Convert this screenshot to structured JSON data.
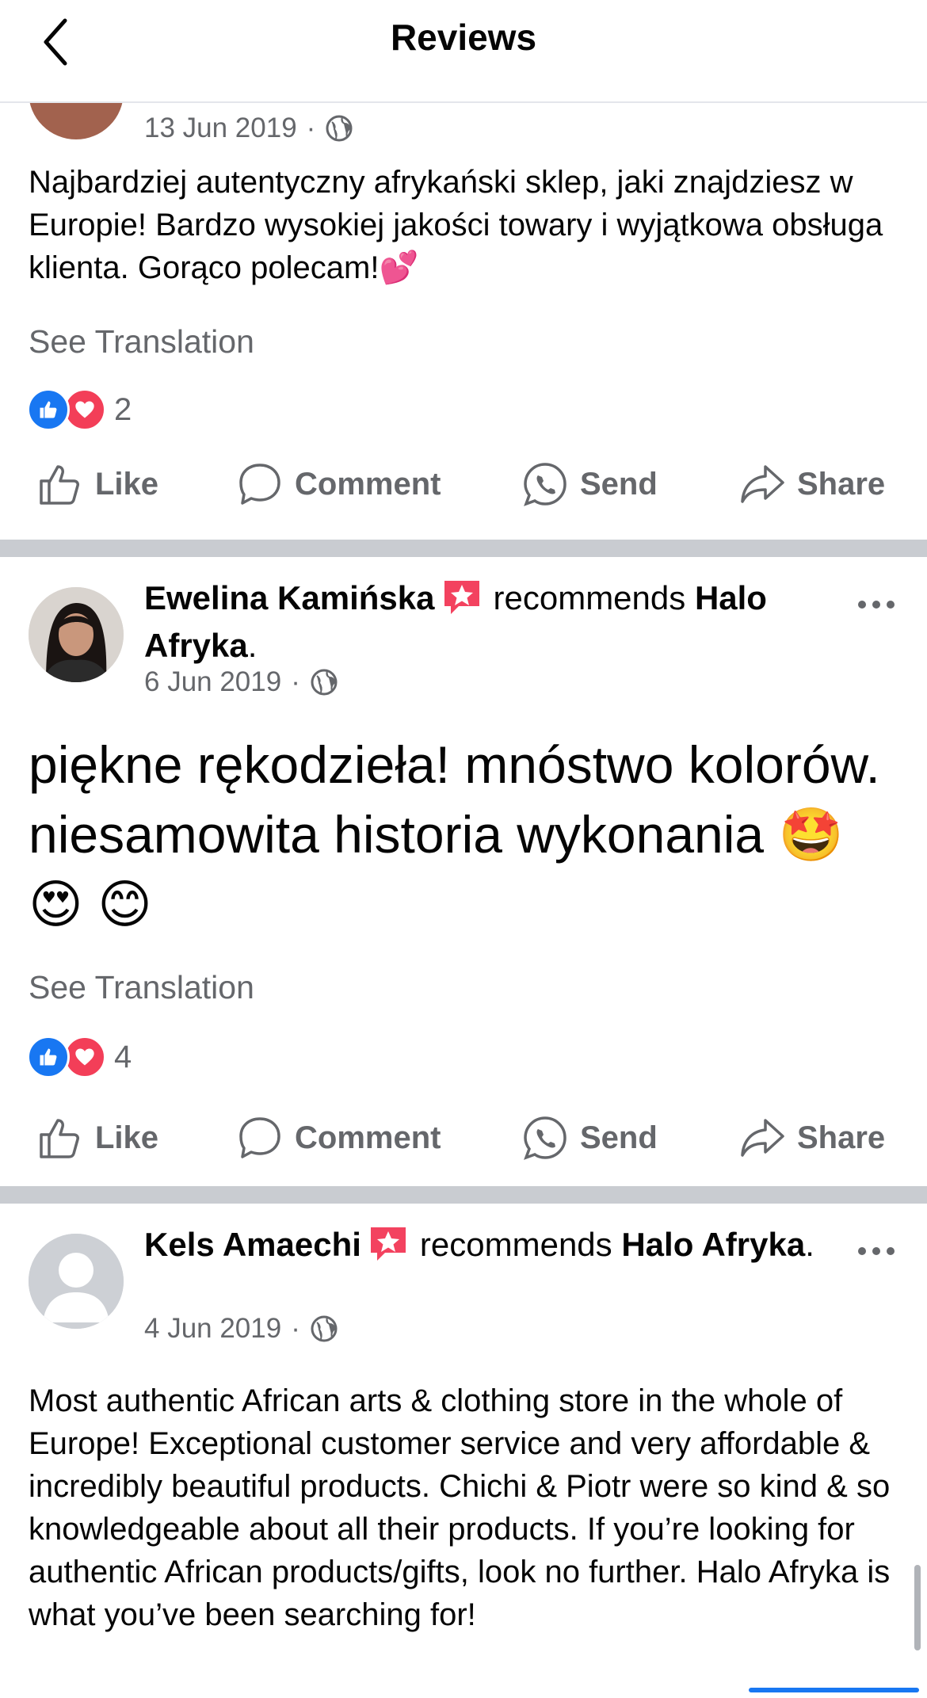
{
  "header": {
    "title": "Reviews"
  },
  "reviews": [
    {
      "date": "13 Jun 2019",
      "text": "Najbardziej autentyczny afrykański sklep, jaki znajdziesz w Europie! Bardzo wysokiej jakości towary i wyjątkowa obsługa klienta. Gorąco polecam!💕",
      "see_translation": "See Translation",
      "reaction_count": "2"
    },
    {
      "name": "Ewelina Kamińska",
      "recommends": "recommends",
      "page": "Halo Afryka",
      "period": ".",
      "date": "6 Jun 2019",
      "text": "piękne rękodzieła! mnóstwo kolorów. niesamowita historia wykonania  🤩 😍 😊",
      "see_translation": "See Translation",
      "reaction_count": "4"
    },
    {
      "name": "Kels Amaechi",
      "recommends": "recommends",
      "page": "Halo Afryka",
      "period": ".",
      "date": "4 Jun 2019",
      "text": "Most authentic African arts & clothing store in the whole of Europe! Exceptional customer service and very affordable & incredibly beautiful products. Chichi & Piotr were so kind & so knowledgeable about all their products. If you’re looking for authentic African products/gifts,  look no further. Halo Afryka is what you’ve been searching for!"
    }
  ],
  "actions": {
    "like": "Like",
    "comment": "Comment",
    "send": "Send",
    "share": "Share"
  },
  "colors": {
    "accent": "#1877f2",
    "love": "#f33e58",
    "secondary_text": "#65676b",
    "divider": "#c9ccd1"
  },
  "icons": [
    "back-icon",
    "globe-icon",
    "recommend-icon",
    "more-icon",
    "like-icon",
    "comment-icon",
    "send-icon",
    "share-icon"
  ]
}
